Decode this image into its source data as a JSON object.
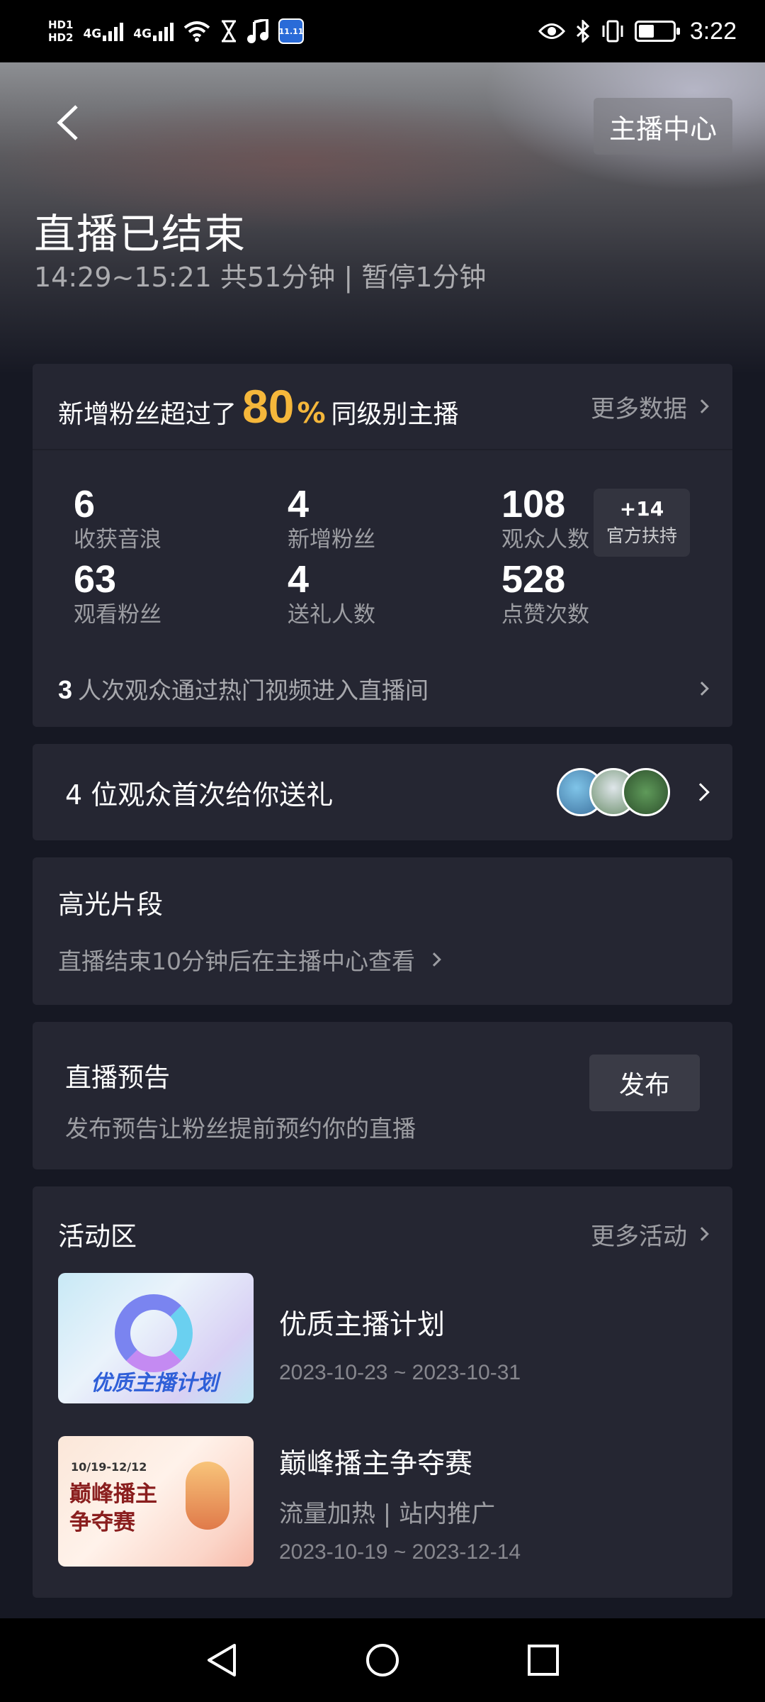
{
  "status_bar": {
    "hd1": "HD1",
    "hd2": "HD2",
    "sig1": "4G",
    "sig2": "4G",
    "time": "3:22",
    "icons": [
      "wifi-icon",
      "hourglass-icon",
      "music-note-icon",
      "app-notification-icon",
      "eye-icon",
      "bluetooth-icon",
      "vibrate-icon",
      "battery-icon"
    ]
  },
  "header": {
    "anchor_center_label": "主播中心",
    "title": "直播已结束",
    "time_info": "14:29~15:21 共51分钟 | 暂停1分钟"
  },
  "stats": {
    "headline_prefix": "新增粉丝超过了",
    "headline_percent": "80",
    "headline_percent_sign": "%",
    "headline_suffix": "同级别主播",
    "more_data_label": "更多数据",
    "items": [
      {
        "value": "6",
        "label": "收获音浪"
      },
      {
        "value": "4",
        "label": "新增粉丝"
      },
      {
        "value": "108",
        "label": "观众人数"
      },
      {
        "value": "63",
        "label": "观看粉丝"
      },
      {
        "value": "4",
        "label": "送礼人数"
      },
      {
        "value": "528",
        "label": "点赞次数"
      }
    ],
    "badge_value": "+14",
    "badge_label": "官方扶持",
    "hot_count": "3",
    "hot_text": "人次观众通过热门视频进入直播间"
  },
  "gift": {
    "text": "4 位观众首次给你送礼"
  },
  "highlights": {
    "title": "高光片段",
    "subtitle": "直播结束10分钟后在主播中心查看"
  },
  "preview": {
    "title": "直播预告",
    "subtitle": "发布预告让粉丝提前预约你的直播",
    "button": "发布"
  },
  "activities": {
    "title": "活动区",
    "more_label": "更多活动",
    "items": [
      {
        "thumb_text": "优质主播计划",
        "name": "优质主播计划",
        "tags": "",
        "date": "2023-10-23 ~ 2023-10-31"
      },
      {
        "thumb_date": "10/19-12/12",
        "thumb_text_line1": "巅峰播主",
        "thumb_text_line2": "争夺赛",
        "name": "巅峰播主争夺赛",
        "tags": "流量加热  |  站内推广",
        "date": "2023-10-19 ~ 2023-12-14"
      }
    ]
  },
  "colors": {
    "background": "#161823",
    "card": "#252632",
    "accent": "#f5b73b"
  }
}
